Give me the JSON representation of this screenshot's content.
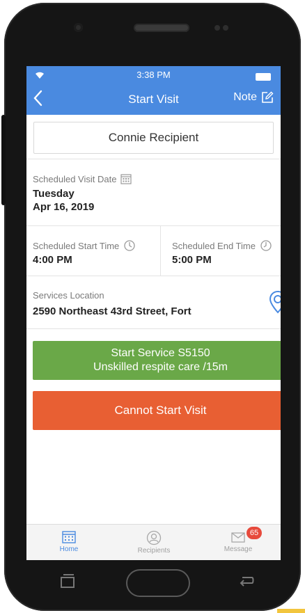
{
  "status_bar": {
    "time": "3:38 PM"
  },
  "header": {
    "title": "Start Visit",
    "note_label": "Note"
  },
  "recipient": {
    "name": "Connie Recipient"
  },
  "visit_date": {
    "label": "Scheduled Visit Date",
    "day": "Tuesday",
    "date": "Apr 16, 2019"
  },
  "start_time": {
    "label": "Scheduled Start Time",
    "value": "4:00 PM"
  },
  "end_time": {
    "label": "Scheduled End Time",
    "value": "5:00 PM"
  },
  "location": {
    "label": "Services Location",
    "address": "2590 Northeast 43rd Street, Fort"
  },
  "buttons": {
    "start_service_line1": "Start Service S5150",
    "start_service_line2": "Unskilled respite care /15m",
    "cannot_start": "Cannot Start Visit"
  },
  "tabbar": {
    "tabs": [
      {
        "label": "Home",
        "active": true,
        "icon": "calendar-icon"
      },
      {
        "label": "Recipients",
        "active": false,
        "icon": "person-icon"
      },
      {
        "label": "Message",
        "active": false,
        "icon": "envelope-icon",
        "badge": "65"
      }
    ]
  },
  "colors": {
    "header": "#4a8ae0",
    "start_button": "#6aa848",
    "cannot_button": "#e85f33",
    "badge": "#e74a3c",
    "accent": "#4a8ae0"
  }
}
